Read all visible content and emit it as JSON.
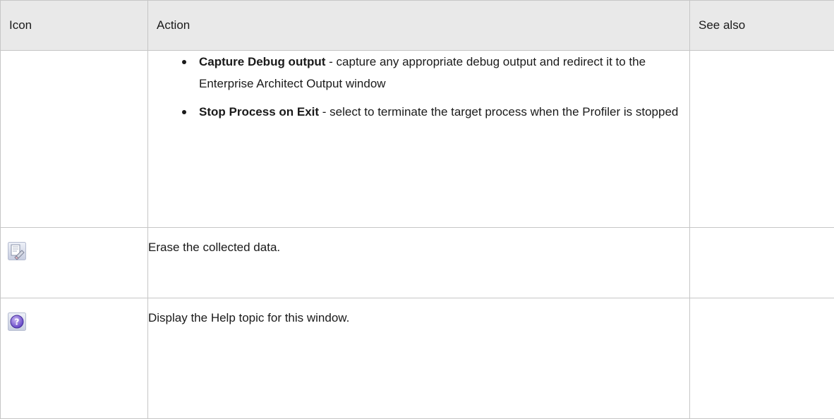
{
  "table": {
    "headers": [
      "Icon",
      "Action",
      "See also"
    ],
    "rows": [
      {
        "icon": "",
        "bullets": [
          {
            "bold": "Capture Debug output",
            "text": " - capture any appropriate debug output and redirect it to the Enterprise Architect Output window"
          },
          {
            "bold": "Stop Process on Exit",
            "text": " - select to terminate the target process when the Profiler is stopped"
          }
        ],
        "see_also": ""
      },
      {
        "icon": "erase-data-icon",
        "action": "Erase the collected data.",
        "see_also": ""
      },
      {
        "icon": "help-icon",
        "action": "Display the Help topic for this window.",
        "see_also": ""
      }
    ]
  }
}
